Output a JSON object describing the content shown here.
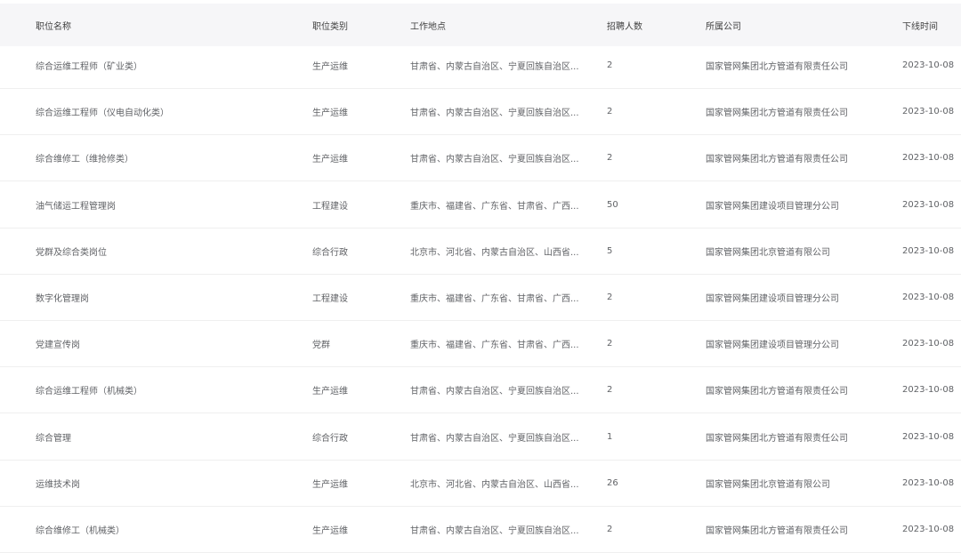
{
  "table": {
    "columns": [
      "职位名称",
      "职位类别",
      "工作地点",
      "招聘人数",
      "所属公司",
      "下线时间"
    ],
    "rows": [
      {
        "name": "综合运维工程师（矿业类）",
        "category": "生产运维",
        "location": "甘肃省、内蒙古自治区、宁夏回族自治区...",
        "count": "2",
        "company": "国家管网集团北方管道有限责任公司",
        "offline": "2023-10-08"
      },
      {
        "name": "综合运维工程师（仪电自动化类）",
        "category": "生产运维",
        "location": "甘肃省、内蒙古自治区、宁夏回族自治区...",
        "count": "2",
        "company": "国家管网集团北方管道有限责任公司",
        "offline": "2023-10-08"
      },
      {
        "name": "综合维修工（维抢修类）",
        "category": "生产运维",
        "location": "甘肃省、内蒙古自治区、宁夏回族自治区...",
        "count": "2",
        "company": "国家管网集团北方管道有限责任公司",
        "offline": "2023-10-08"
      },
      {
        "name": "油气储运工程管理岗",
        "category": "工程建设",
        "location": "重庆市、福建省、广东省、甘肃省、广西...",
        "count": "50",
        "company": "国家管网集团建设项目管理分公司",
        "offline": "2023-10-08"
      },
      {
        "name": "党群及综合类岗位",
        "category": "综合行政",
        "location": "北京市、河北省、内蒙古自治区、山西省...",
        "count": "5",
        "company": "国家管网集团北京管道有限公司",
        "offline": "2023-10-08"
      },
      {
        "name": "数字化管理岗",
        "category": "工程建设",
        "location": "重庆市、福建省、广东省、甘肃省、广西...",
        "count": "2",
        "company": "国家管网集团建设项目管理分公司",
        "offline": "2023-10-08"
      },
      {
        "name": "党建宣传岗",
        "category": "党群",
        "location": "重庆市、福建省、广东省、甘肃省、广西...",
        "count": "2",
        "company": "国家管网集团建设项目管理分公司",
        "offline": "2023-10-08"
      },
      {
        "name": "综合运维工程师（机械类）",
        "category": "生产运维",
        "location": "甘肃省、内蒙古自治区、宁夏回族自治区...",
        "count": "2",
        "company": "国家管网集团北方管道有限责任公司",
        "offline": "2023-10-08"
      },
      {
        "name": "综合管理",
        "category": "综合行政",
        "location": "甘肃省、内蒙古自治区、宁夏回族自治区...",
        "count": "1",
        "company": "国家管网集团北方管道有限责任公司",
        "offline": "2023-10-08"
      },
      {
        "name": "运维技术岗",
        "category": "生产运维",
        "location": "北京市、河北省、内蒙古自治区、山西省...",
        "count": "26",
        "company": "国家管网集团北京管道有限公司",
        "offline": "2023-10-08"
      },
      {
        "name": "综合维修工（机械类）",
        "category": "生产运维",
        "location": "甘肃省、内蒙古自治区、宁夏回族自治区...",
        "count": "2",
        "company": "国家管网集团北方管道有限责任公司",
        "offline": "2023-10-08"
      }
    ]
  }
}
